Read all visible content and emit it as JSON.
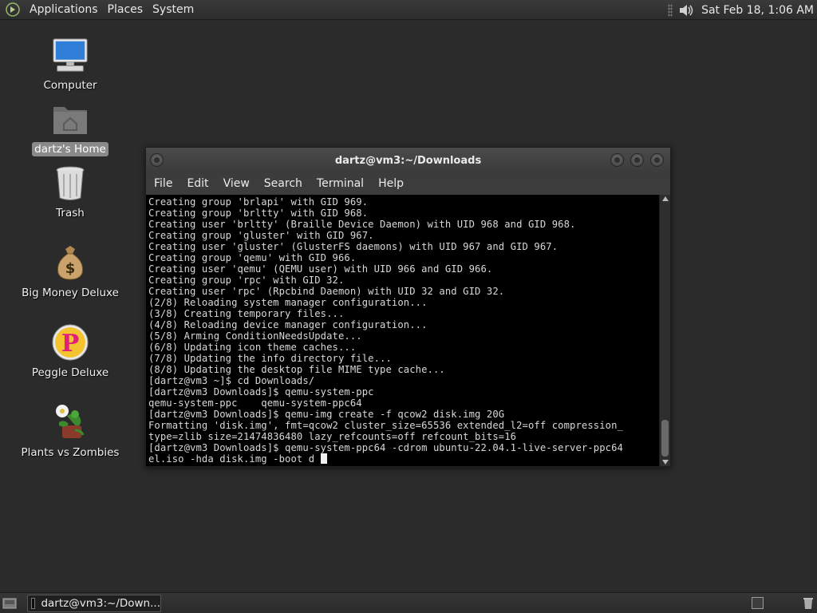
{
  "top_panel": {
    "menus": [
      "Applications",
      "Places",
      "System"
    ],
    "clock": "Sat Feb 18,  1:06 AM"
  },
  "desktop": {
    "icons": [
      {
        "label": "Computer",
        "icon": "computer-icon"
      },
      {
        "label": "dartz's Home",
        "icon": "home-folder-icon",
        "selected": true
      },
      {
        "label": "Trash",
        "icon": "trash-icon"
      },
      {
        "label": "Big Money Deluxe",
        "icon": "money-bag-icon"
      },
      {
        "label": "Peggle Deluxe",
        "icon": "peggle-icon"
      },
      {
        "label": "Plants vs Zombies",
        "icon": "plants-vs-zombies-icon"
      }
    ]
  },
  "terminal": {
    "title": "dartz@vm3:~/Downloads",
    "menu": [
      "File",
      "Edit",
      "View",
      "Search",
      "Terminal",
      "Help"
    ],
    "lines": [
      "Creating group 'brlapi' with GID 969.",
      "Creating group 'brltty' with GID 968.",
      "Creating user 'brltty' (Braille Device Daemon) with UID 968 and GID 968.",
      "Creating group 'gluster' with GID 967.",
      "Creating user 'gluster' (GlusterFS daemons) with UID 967 and GID 967.",
      "Creating group 'qemu' with GID 966.",
      "Creating user 'qemu' (QEMU user) with UID 966 and GID 966.",
      "Creating group 'rpc' with GID 32.",
      "Creating user 'rpc' (Rpcbind Daemon) with UID 32 and GID 32.",
      "(2/8) Reloading system manager configuration...",
      "(3/8) Creating temporary files...",
      "(4/8) Reloading device manager configuration...",
      "(5/8) Arming ConditionNeedsUpdate...",
      "(6/8) Updating icon theme caches...",
      "(7/8) Updating the info directory file...",
      "(8/8) Updating the desktop file MIME type cache...",
      "[dartz@vm3 ~]$ cd Downloads/",
      "[dartz@vm3 Downloads]$ qemu-system-ppc",
      "qemu-system-ppc    qemu-system-ppc64",
      "[dartz@vm3 Downloads]$ qemu-img create -f qcow2 disk.img 20G",
      "Formatting 'disk.img', fmt=qcow2 cluster_size=65536 extended_l2=off compression_",
      "type=zlib size=21474836480 lazy_refcounts=off refcount_bits=16",
      "[dartz@vm3 Downloads]$ qemu-system-ppc64 -cdrom ubuntu-22.04.1-live-server-ppc64",
      "el.iso -hda disk.img -boot d "
    ]
  },
  "bottom_panel": {
    "task_label": "dartz@vm3:~/Down..."
  }
}
